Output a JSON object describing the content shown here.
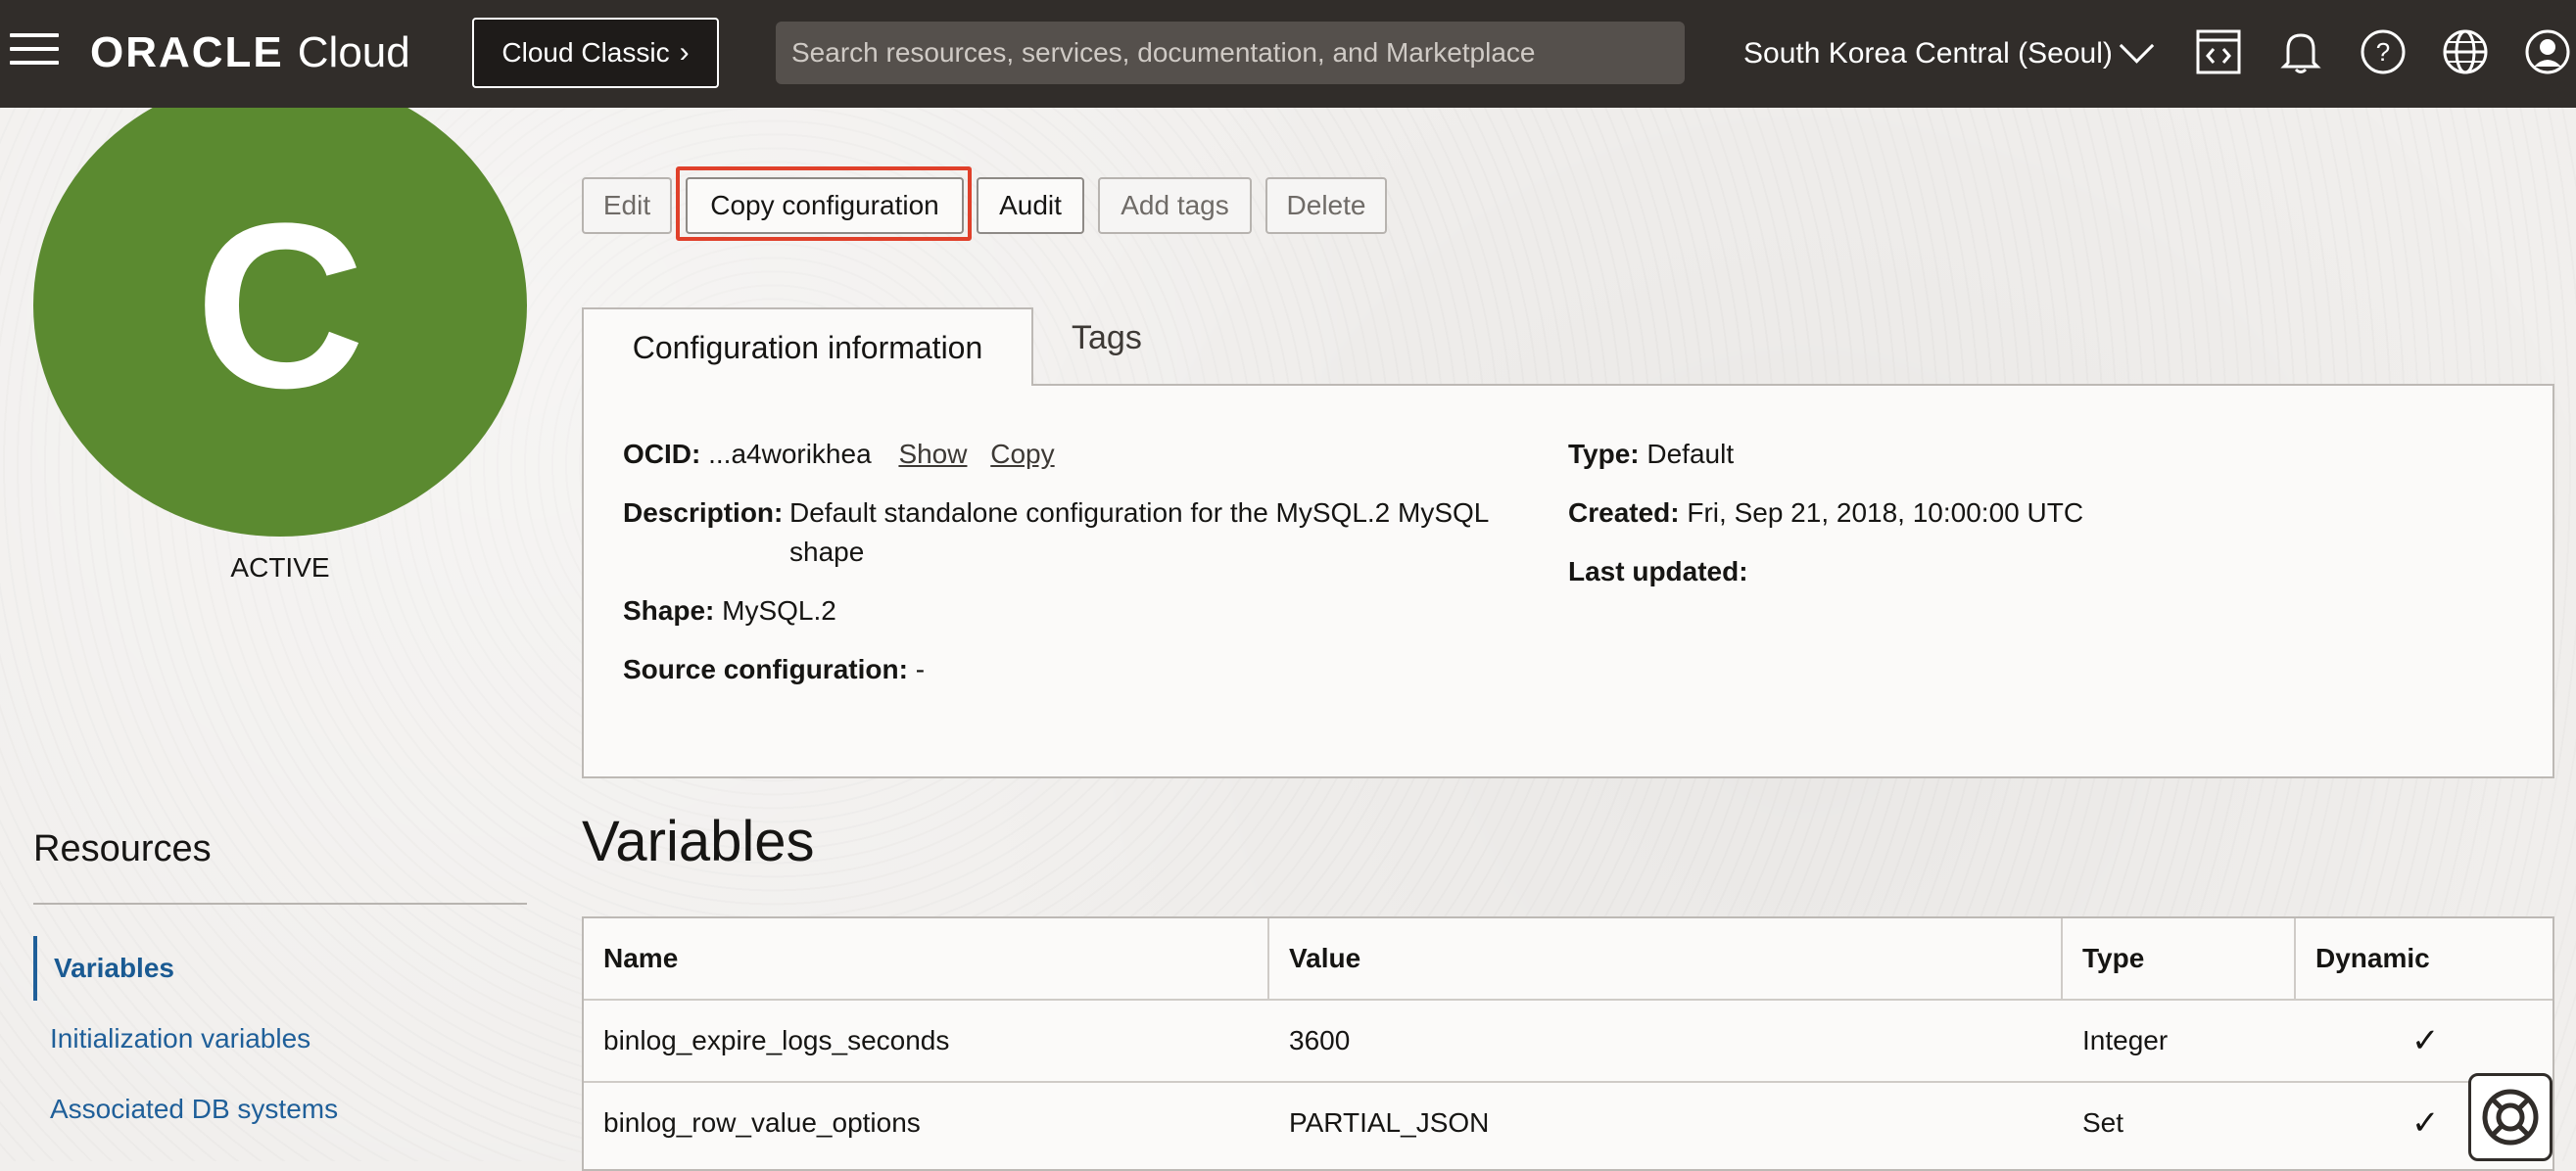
{
  "header": {
    "logo_text": "ORACLE",
    "logo_sub": "Cloud",
    "classic_button": "Cloud Classic",
    "search_placeholder": "Search resources, services, documentation, and Marketplace",
    "region": "South Korea Central (Seoul)",
    "icons": [
      "code-editor-icon",
      "bell-icon",
      "help-icon",
      "globe-icon",
      "user-icon"
    ]
  },
  "sidebar": {
    "avatar_letter": "C",
    "status": "ACTIVE",
    "resources_title": "Resources",
    "items": [
      {
        "label": "Variables",
        "active": true
      },
      {
        "label": "Initialization variables",
        "active": false
      },
      {
        "label": "Associated DB systems",
        "active": false
      }
    ]
  },
  "actions": {
    "edit": "Edit",
    "copy_configuration": "Copy configuration",
    "audit": "Audit",
    "add_tags": "Add tags",
    "delete": "Delete"
  },
  "tabs": {
    "active": "Configuration information",
    "other": "Tags"
  },
  "info": {
    "ocid_label": "OCID:",
    "ocid_value": "...a4worikhea",
    "show": "Show",
    "copy": "Copy",
    "description_label": "Description:",
    "description_line1": "Default standalone configuration for the MySQL.2 MySQL",
    "description_line2": "shape",
    "shape_label": "Shape:",
    "shape_value": "MySQL.2",
    "source_label": "Source configuration:",
    "source_value": "-",
    "type_label": "Type:",
    "type_value": "Default",
    "created_label": "Created:",
    "created_value": "Fri, Sep 21, 2018, 10:00:00 UTC",
    "updated_label": "Last updated:",
    "updated_value": ""
  },
  "variables": {
    "title": "Variables",
    "columns": [
      "Name",
      "Value",
      "Type",
      "Dynamic"
    ],
    "rows": [
      {
        "name": "binlog_expire_logs_seconds",
        "value": "3600",
        "type": "Integer",
        "dynamic": "✓"
      },
      {
        "name": "binlog_row_value_options",
        "value": "PARTIAL_JSON",
        "type": "Set",
        "dynamic": "✓"
      }
    ]
  }
}
